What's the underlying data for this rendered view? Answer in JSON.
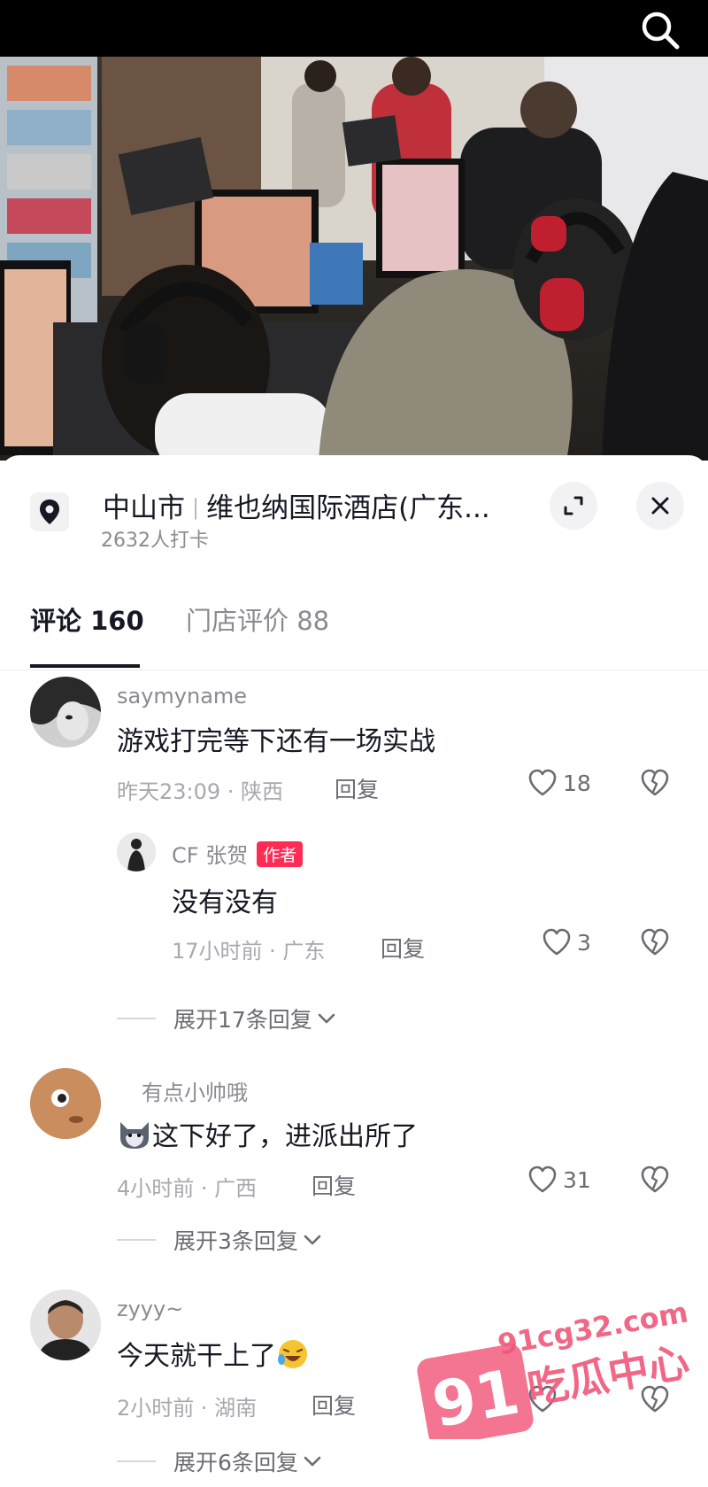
{
  "location": {
    "city": "中山市",
    "place": "维也纳国际酒店(广东...",
    "checkins": "2632人打卡"
  },
  "tabs": {
    "comments": "评论 160",
    "reviews": "门店评价 88"
  },
  "comments": [
    {
      "username": "saymyname",
      "text": "游戏打完等下还有一场实战",
      "meta": "昨天23:09 · 陕西",
      "reply_label": "回复",
      "likes": "18",
      "replies": [
        {
          "username": "CF 张贺",
          "badge": "作者",
          "text": "没有没有",
          "meta": "17小时前 · 广东",
          "reply_label": "回复",
          "likes": "3"
        }
      ],
      "expand_label": "展开17条回复"
    },
    {
      "username": "有点小帅哦",
      "text": "这下好了，进派出所了",
      "meta": "4小时前 · 广西",
      "reply_label": "回复",
      "likes": "31",
      "expand_label": "展开3条回复"
    },
    {
      "username": "zyyy~",
      "text": "今天就干上了",
      "meta": "2小时前 · 湖南",
      "reply_label": "回复",
      "likes": "",
      "expand_label": "展开6条回复"
    }
  ],
  "watermark": {
    "site": "91cg32.com",
    "number": "91",
    "name": "吃瓜中心"
  },
  "colors": {
    "accent": "#fe2c55",
    "text_primary": "#161823",
    "text_secondary": "#8a8b91"
  }
}
